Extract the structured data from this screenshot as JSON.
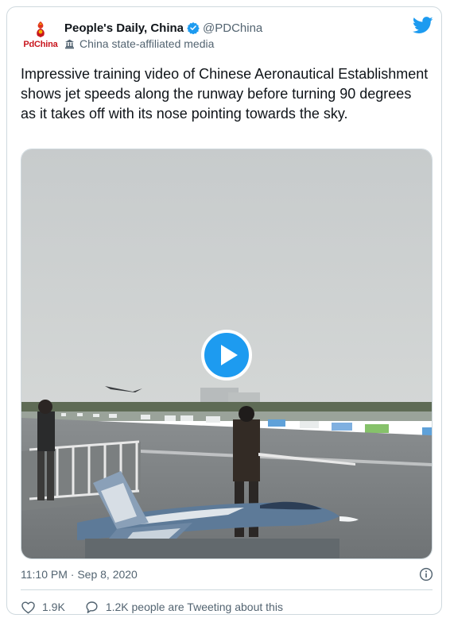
{
  "author": {
    "display_name": "People's Daily, China",
    "handle": "@PDChina",
    "avatar_text": "PdChina",
    "label": "China state-affiliated media",
    "verified": true
  },
  "tweet": {
    "text": "Impressive training video of Chinese Aeronautical Establishment shows jet speeds along the runway before turning 90 degrees as it takes off with its nose pointing towards the sky.",
    "timestamp": "11:10 PM · Sep 8, 2020"
  },
  "engagement": {
    "likes": "1.9K",
    "tweeting_about": "1.2K people are Tweeting about this"
  },
  "colors": {
    "twitter_blue": "#1d9bf0",
    "text_primary": "#0f1419",
    "text_secondary": "#536471",
    "border": "#cfd9de",
    "brand_red": "#c8161e"
  },
  "icons": {
    "verified": "verified-badge-icon",
    "label": "building-icon",
    "logo": "twitter-bird-icon",
    "play": "play-icon",
    "info": "info-icon",
    "like": "heart-icon",
    "reply": "speech-bubble-icon"
  }
}
